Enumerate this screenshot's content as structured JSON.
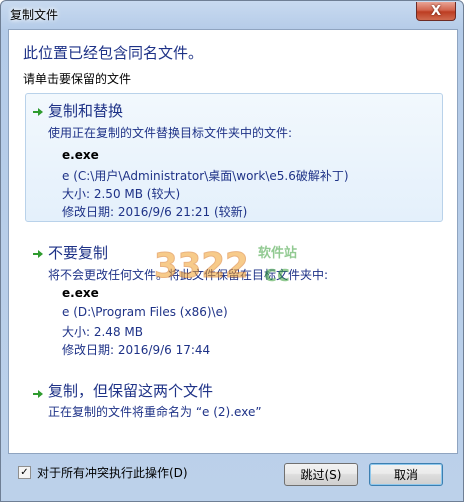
{
  "window": {
    "title": "复制文件",
    "close_label": "X"
  },
  "heading": "此位置已经包含同名文件。",
  "subheading": "请单击要保留的文件",
  "options": [
    {
      "title": "复制和替换",
      "description": "使用正在复制的文件替换目标文件夹中的文件:",
      "file": {
        "name": "e.exe",
        "path": "e (C:\\用户\\Administrator\\桌面\\work\\e5.6破解补丁)",
        "size": "大小: 2.50 MB (较大)",
        "modified": "修改日期: 2016/9/6 21:21 (较新)"
      }
    },
    {
      "title": "不要复制",
      "description": "将不会更改任何文件。将此文件保留在目标文件夹中:",
      "file": {
        "name": "e.exe",
        "path": "e (D:\\Program Files (x86)\\e)",
        "size": "大小: 2.48 MB",
        "modified": "修改日期: 2016/9/6 17:44"
      }
    },
    {
      "title": "复制，但保留这两个文件",
      "description": "正在复制的文件将重命名为 “e (2).exe”"
    }
  ],
  "watermark": {
    "text": "软件站",
    "digits": "3322",
    "suffix": "cc"
  },
  "footer": {
    "checkbox_label": "对于所有冲突执行此操作(D)",
    "checkbox_checked": true,
    "skip_label": "跳过(S)",
    "cancel_label": "取消"
  },
  "colors": {
    "link_blue": "#1e3287",
    "arrow_green": "#2e9b2e"
  }
}
